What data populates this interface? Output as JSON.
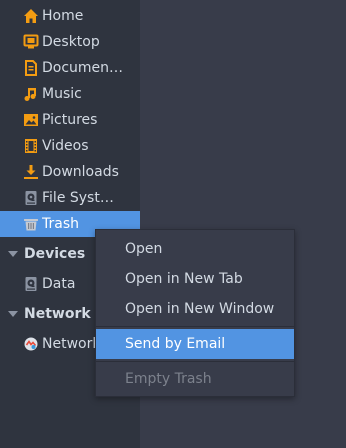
{
  "sidebar": {
    "places": [
      {
        "label": "Home",
        "icon": "home-icon"
      },
      {
        "label": "Desktop",
        "icon": "desktop-icon"
      },
      {
        "label": "Documen…",
        "icon": "documents-icon"
      },
      {
        "label": "Music",
        "icon": "music-icon"
      },
      {
        "label": "Pictures",
        "icon": "pictures-icon"
      },
      {
        "label": "Videos",
        "icon": "videos-icon"
      },
      {
        "label": "Downloads",
        "icon": "downloads-icon"
      },
      {
        "label": "File Syst…",
        "icon": "drive-icon"
      },
      {
        "label": "Trash",
        "icon": "trash-icon",
        "selected": true
      }
    ],
    "devices": {
      "header": "Devices",
      "items": [
        {
          "label": "Data",
          "icon": "drive-icon"
        }
      ]
    },
    "network": {
      "header": "Network",
      "items": [
        {
          "label": "Network",
          "icon": "network-icon"
        }
      ]
    }
  },
  "context_menu": {
    "items": [
      {
        "label": "Open",
        "state": "normal"
      },
      {
        "label": "Open in New Tab",
        "state": "normal"
      },
      {
        "label": "Open in New Window",
        "state": "normal"
      },
      {
        "label": "Send by Email",
        "state": "highlighted"
      },
      {
        "label": "Empty Trash",
        "state": "disabled"
      }
    ]
  },
  "colors": {
    "accent": "#5294e2",
    "folder_orange": "#f39c12",
    "sidebar_bg": "#2f343f",
    "window_bg": "#383c4a"
  }
}
